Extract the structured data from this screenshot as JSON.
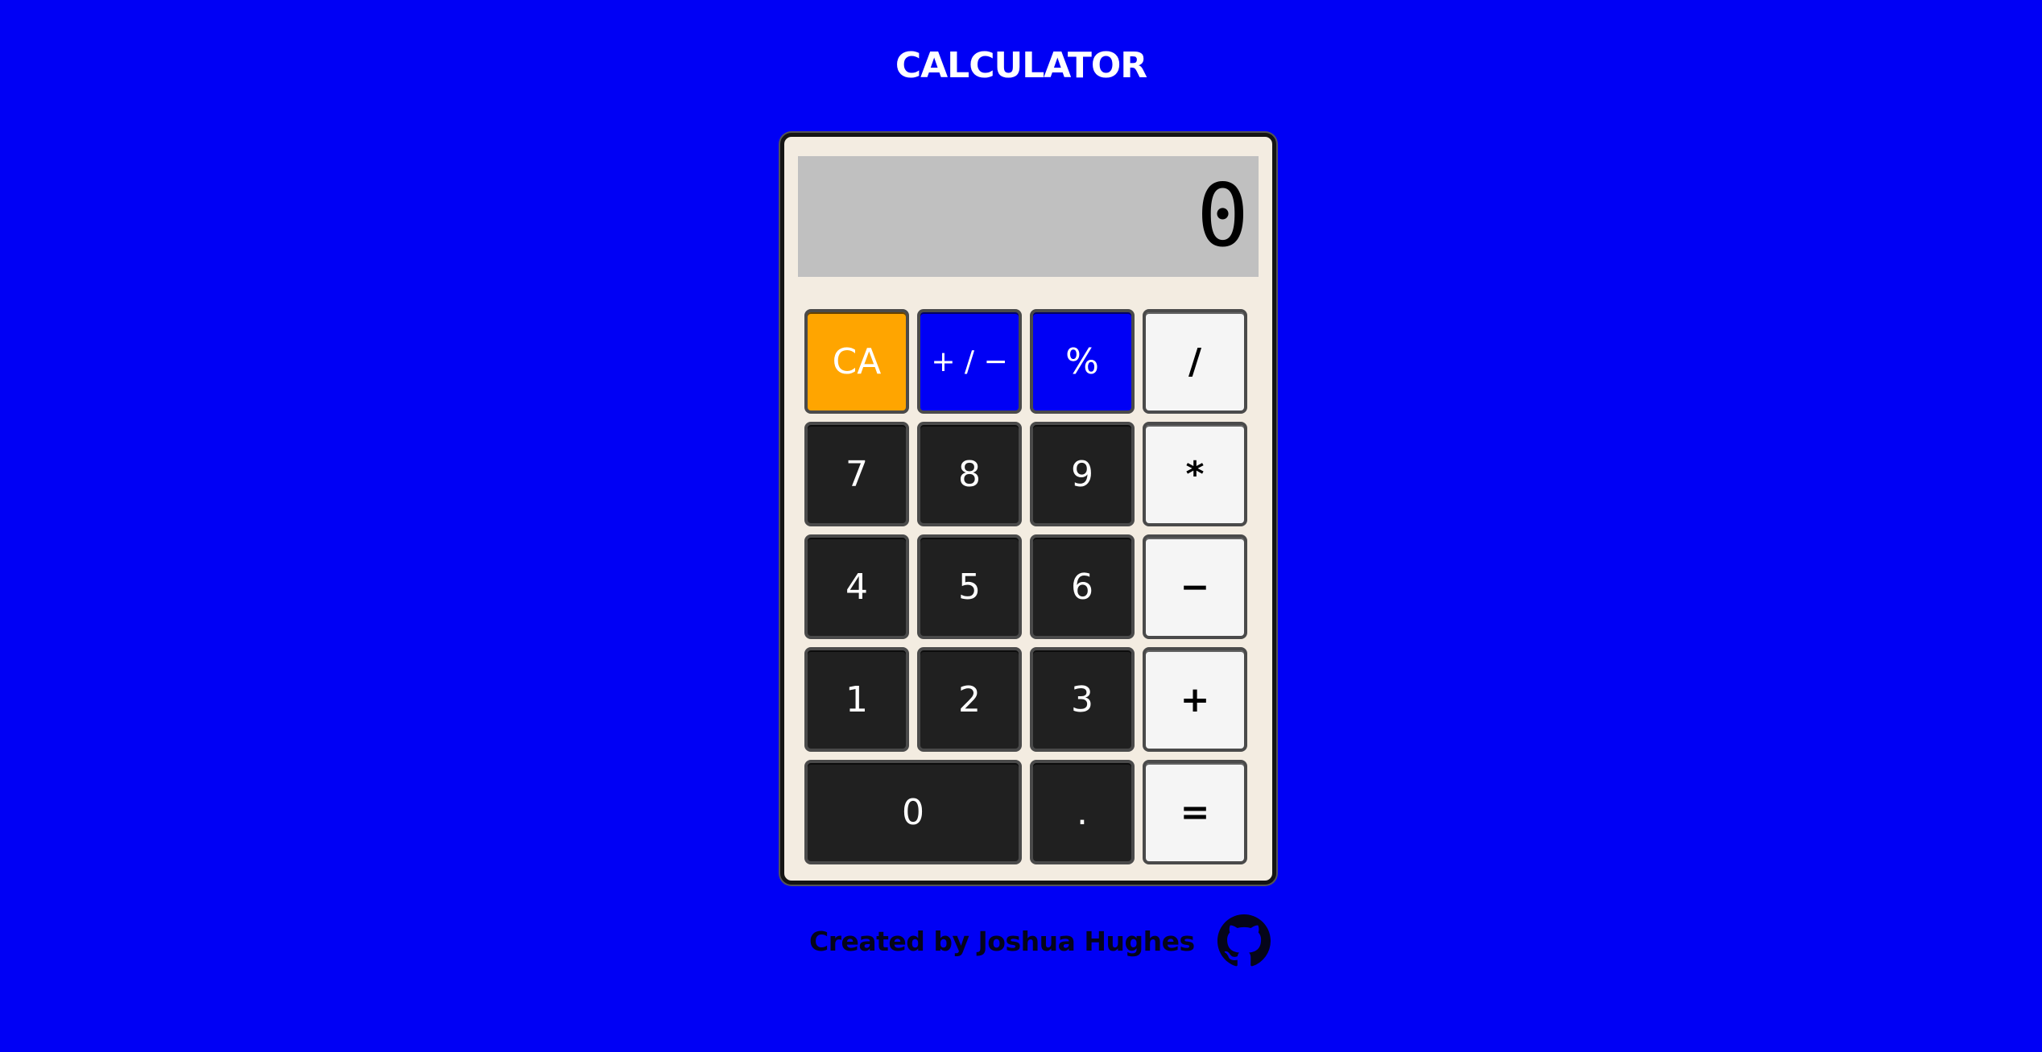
{
  "title": "CALCULATOR",
  "display": {
    "value": "0"
  },
  "keys": {
    "clear": "CA",
    "sign": "+ / −",
    "percent": "%",
    "divide": "/",
    "seven": "7",
    "eight": "8",
    "nine": "9",
    "multiply": "*",
    "four": "4",
    "five": "5",
    "six": "6",
    "subtract": "−",
    "one": "1",
    "two": "2",
    "three": "3",
    "add": "+",
    "zero": "0",
    "decimal": ".",
    "equals": "="
  },
  "footer": {
    "credit": "Created by Joshua Hughes",
    "icon": "github-icon"
  },
  "colors": {
    "background": "#0000f5",
    "clear_key": "#ffa500",
    "function_key": "#0000f5",
    "digit_key": "#202020",
    "operator_key": "#f5f5f5",
    "display": "#c0c0c0",
    "body": "#f3ece1"
  }
}
